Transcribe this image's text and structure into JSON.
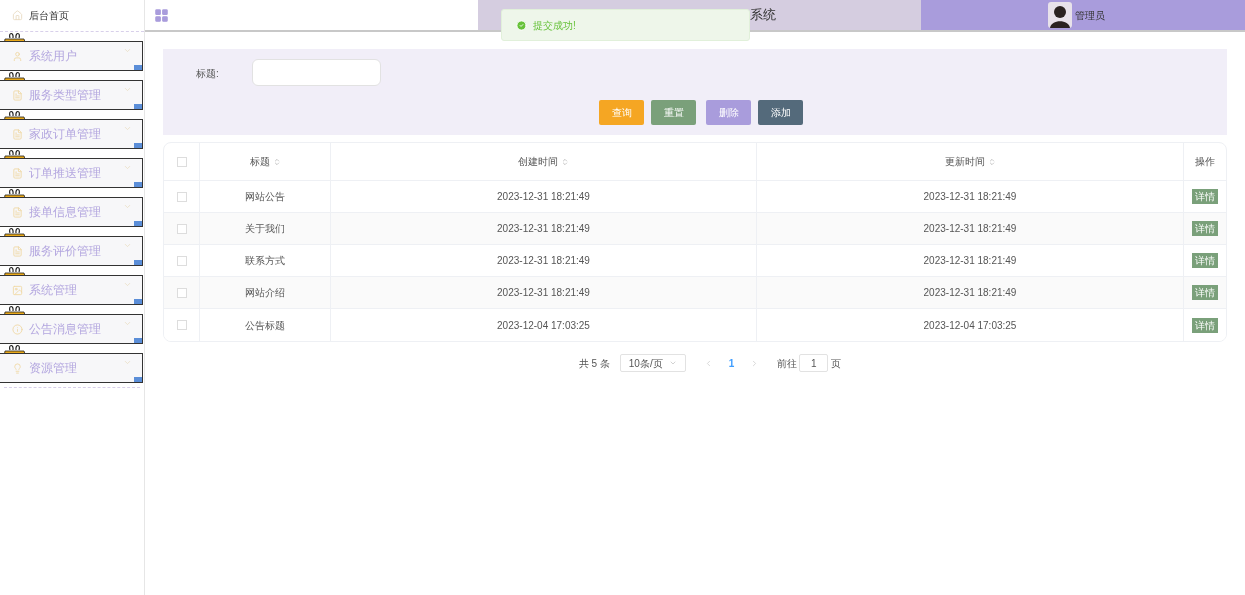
{
  "sidebar": {
    "home": "后台首页",
    "items": [
      {
        "label": "系统用户",
        "kind": "user"
      },
      {
        "label": "服务类型管理",
        "kind": "doc"
      },
      {
        "label": "家政订单管理",
        "kind": "doc"
      },
      {
        "label": "订单推送管理",
        "kind": "doc"
      },
      {
        "label": "接单信息管理",
        "kind": "doc"
      },
      {
        "label": "服务评价管理",
        "kind": "doc"
      },
      {
        "label": "系统管理",
        "kind": "image"
      },
      {
        "label": "公告消息管理",
        "kind": "info"
      },
      {
        "label": "资源管理",
        "kind": "bulb"
      }
    ]
  },
  "header": {
    "title": "系统",
    "user": "管理员"
  },
  "toast": {
    "message": "提交成功!"
  },
  "search": {
    "label": "标题:",
    "buttons": [
      {
        "label": "查询",
        "color": "#f5a623"
      },
      {
        "label": "重置",
        "color": "#7aa07a"
      },
      {
        "label": "删除",
        "color": "#a99cdc"
      },
      {
        "label": "添加",
        "color": "#546a7b"
      }
    ]
  },
  "table": {
    "all_checked": false,
    "columns": [
      "标题",
      "创建时间",
      "更新时间",
      "操作"
    ],
    "rows": [
      {
        "title": "网站公告",
        "created": "2023-12-31 18:21:49",
        "updated": "2023-12-31 18:21:49",
        "action": "详情",
        "checked": false
      },
      {
        "title": "关于我们",
        "created": "2023-12-31 18:21:49",
        "updated": "2023-12-31 18:21:49",
        "action": "详情",
        "checked": false
      },
      {
        "title": "联系方式",
        "created": "2023-12-31 18:21:49",
        "updated": "2023-12-31 18:21:49",
        "action": "详情",
        "checked": false
      },
      {
        "title": "网站介绍",
        "created": "2023-12-31 18:21:49",
        "updated": "2023-12-31 18:21:49",
        "action": "详情",
        "checked": false
      },
      {
        "title": "公告标题",
        "created": "2023-12-04 17:03:25",
        "updated": "2023-12-04 17:03:25",
        "action": "详情",
        "checked": false
      }
    ]
  },
  "pagination": {
    "total": "共 5 条",
    "page_size": "10条/页",
    "current": "1",
    "goto_label": "前往",
    "goto_value": "1",
    "goto_suffix": "页"
  }
}
